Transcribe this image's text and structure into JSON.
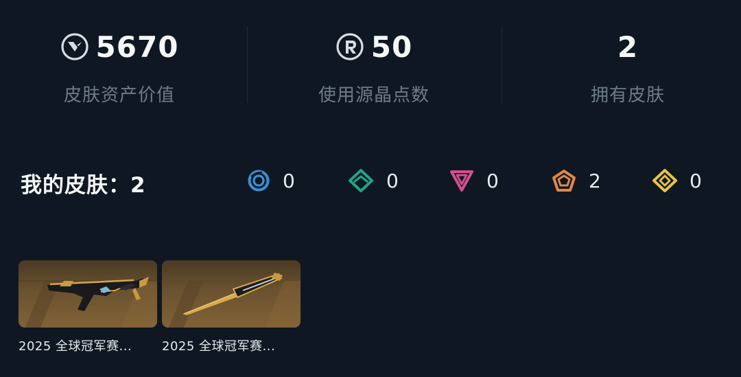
{
  "stats": {
    "asset_value": {
      "value": "5670",
      "label": "皮肤资产价值",
      "icon": "valorant-points-icon"
    },
    "radianite_used": {
      "value": "50",
      "label": "使用源晶点数",
      "icon": "radianite-points-icon"
    },
    "owned_skins": {
      "value": "2",
      "label": "拥有皮肤"
    }
  },
  "my_skins": {
    "title": "我的皮肤：",
    "count": "2",
    "rarities": [
      {
        "icon": "select-tier-icon",
        "color": "#3a8fd6",
        "count": "0"
      },
      {
        "icon": "deluxe-tier-icon",
        "color": "#1fa586",
        "count": "0"
      },
      {
        "icon": "premium-tier-icon",
        "color": "#d2508f",
        "count": "0"
      },
      {
        "icon": "exclusive-tier-icon",
        "color": "#e0894a",
        "count": "2"
      },
      {
        "icon": "ultra-tier-icon",
        "color": "#e8c244",
        "count": "0"
      }
    ]
  },
  "skins": [
    {
      "title": "2025 全球冠军赛...",
      "weapon": "rifle"
    },
    {
      "title": "2025 全球冠军赛...",
      "weapon": "knife"
    }
  ],
  "colors": {
    "background": "#0f1822",
    "label": "#6f7b88",
    "card_gold": "#806236"
  }
}
